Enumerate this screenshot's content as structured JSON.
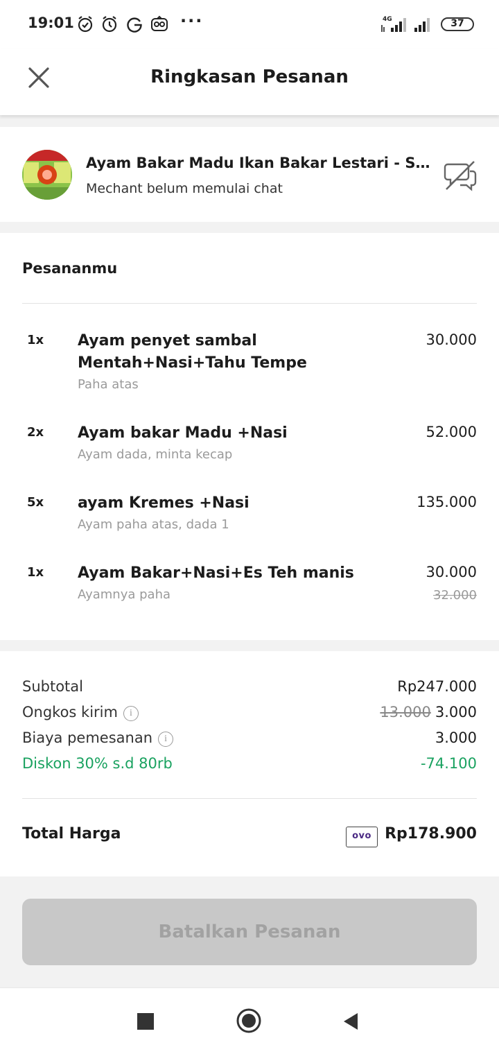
{
  "status_bar": {
    "time": "19:01",
    "icons": [
      "alarm-check-icon",
      "alarm-icon",
      "google-icon",
      "tripadvisor-icon"
    ],
    "more": "···",
    "network": "4G",
    "battery": "37"
  },
  "header": {
    "title": "Ringkasan Pesanan",
    "close_icon": "close-icon"
  },
  "merchant": {
    "name": "Ayam Bakar Madu Ikan Bakar Lestari - Sukahaji",
    "status": "Mechant belum memulai chat",
    "chat_icon": "chat-disabled-icon"
  },
  "orders": {
    "heading": "Pesananmu",
    "items": [
      {
        "qty": "1x",
        "name": "Ayam penyet sambal Mentah+Nasi+Tahu Tempe",
        "note": "Paha atas",
        "price": "30.000",
        "old_price": ""
      },
      {
        "qty": "2x",
        "name": "Ayam bakar Madu +Nasi",
        "note": "Ayam dada, minta kecap",
        "price": "52.000",
        "old_price": ""
      },
      {
        "qty": "5x",
        "name": "ayam Kremes +Nasi",
        "note": "Ayam paha atas, dada 1",
        "price": "135.000",
        "old_price": ""
      },
      {
        "qty": "1x",
        "name": "Ayam Bakar+Nasi+Es Teh manis",
        "note": "Ayamnya paha",
        "price": "30.000",
        "old_price": "32.000"
      }
    ]
  },
  "summary": {
    "subtotal_label": "Subtotal",
    "subtotal_value": "Rp247.000",
    "delivery_label": "Ongkos kirim",
    "delivery_old": "13.000",
    "delivery_value": "3.000",
    "fee_label": "Biaya pemesanan",
    "fee_value": "3.000",
    "discount_label": "Diskon 30% s.d 80rb",
    "discount_value": "-74.100",
    "info_glyph": "i",
    "total_label": "Total Harga",
    "payment_method": "ovo",
    "total_value": "Rp178.900"
  },
  "actions": {
    "cancel_label": "Batalkan Pesanan"
  },
  "colors": {
    "discount_green": "#1aa260",
    "disabled_button": "#c8c8c8"
  },
  "nav": {
    "icons": [
      "recents-icon",
      "home-icon",
      "back-icon"
    ]
  }
}
